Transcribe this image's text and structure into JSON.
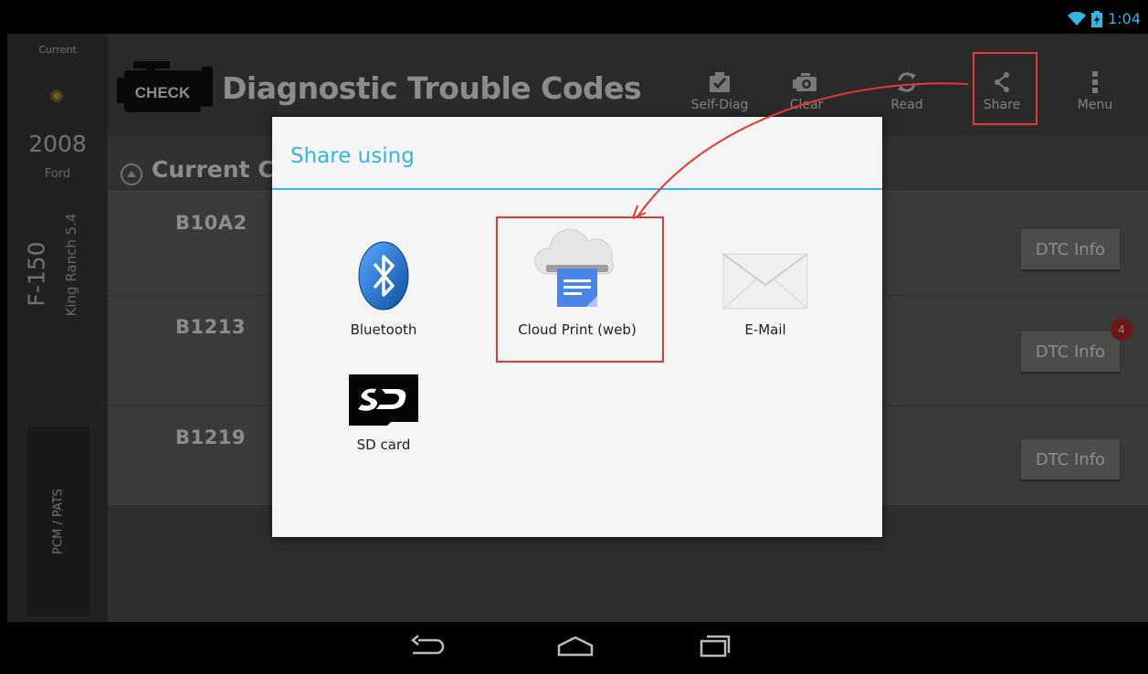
{
  "status_bar": {
    "time": "1:04"
  },
  "sidebar": {
    "current_label": "Current",
    "year": "2008",
    "make": "Ford",
    "model": "F-150",
    "trim": "King Ranch 5.4",
    "module": "PCM / PATS"
  },
  "header": {
    "icon_text": "CHECK",
    "title": "Diagnostic Trouble Codes",
    "actions": [
      {
        "label": "Self-Diag",
        "icon": "self-diag-icon"
      },
      {
        "label": "Clear",
        "icon": "engine-clear-icon"
      },
      {
        "label": "Read",
        "icon": "refresh-icon"
      },
      {
        "label": "Share",
        "icon": "share-icon"
      },
      {
        "label": "Menu",
        "icon": "overflow-menu-icon"
      }
    ]
  },
  "section": {
    "title": "Current Codes"
  },
  "codes": [
    {
      "code": "B10A2",
      "button": "DTC Info"
    },
    {
      "code": "B1213",
      "button": "DTC Info",
      "badge": "4"
    },
    {
      "code": "B1219",
      "button": "DTC Info"
    }
  ],
  "dialog": {
    "title": "Share using",
    "options": [
      {
        "label": "Bluetooth",
        "icon": "bluetooth-icon"
      },
      {
        "label": "Cloud Print (web)",
        "icon": "cloud-print-icon"
      },
      {
        "label": "E-Mail",
        "icon": "email-icon"
      },
      {
        "label": "SD card",
        "icon": "sd-card-icon"
      }
    ]
  },
  "colors": {
    "accent": "#33b5e5",
    "highlight": "#e53935",
    "badge": "#c62828"
  }
}
